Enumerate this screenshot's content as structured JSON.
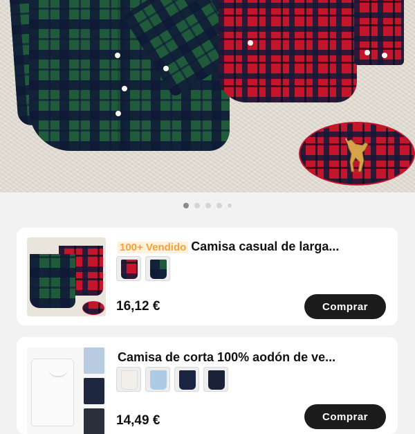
{
  "hero": {
    "carousel": {
      "pages": 5,
      "active_index": 0
    }
  },
  "products": [
    {
      "sold_badge": "100+ Vendido",
      "title": "Camisa casual de larga...",
      "variants": [
        "red-tartan",
        "green-tartan"
      ],
      "price": "16,12 €",
      "buy_label": "Comprar"
    },
    {
      "title": "Camisa de  corta 100% aodón de ve...",
      "variants": [
        "cream",
        "light-blue",
        "navy",
        "navy-dark"
      ],
      "price": "14,49 €",
      "buy_label": "Comprar"
    }
  ],
  "colors": {
    "buy_button_bg": "#1c1c1c",
    "sold_badge_text": "#f2a23a",
    "sold_badge_bg": "#fff1dc",
    "page_bg": "#f2f2f2"
  }
}
